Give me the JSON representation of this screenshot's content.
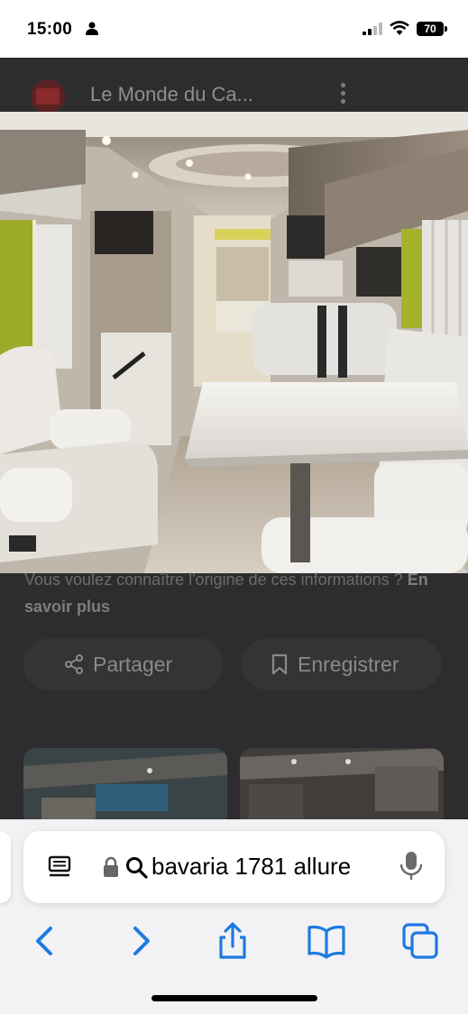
{
  "status_bar": {
    "time": "15:00",
    "battery": "70"
  },
  "site": {
    "name": "Le Monde du Ca..."
  },
  "info": {
    "text": "Vous voulez connaître l'origine de ces informations ?",
    "link": "En savoir plus"
  },
  "actions": {
    "share_label": "Partager",
    "save_label": "Enregistrer"
  },
  "address_bar": {
    "query": "bavaria 1781 allure"
  },
  "icons": {
    "status": [
      "person-icon",
      "signal-icon",
      "wifi-icon",
      "battery-icon"
    ],
    "site": [
      "site-logo",
      "more-icon"
    ],
    "actions": [
      "share-icon",
      "bookmark-icon"
    ],
    "address": [
      "reader-icon",
      "lock-icon",
      "search-icon",
      "mic-icon"
    ],
    "nav": [
      "back-icon",
      "forward-icon",
      "share-icon",
      "bookmarks-icon",
      "tabs-icon"
    ]
  },
  "colors": {
    "accent": "#1e7ae0",
    "overlay": "#2d2d2f",
    "toolbar": "#f2f2f4"
  }
}
